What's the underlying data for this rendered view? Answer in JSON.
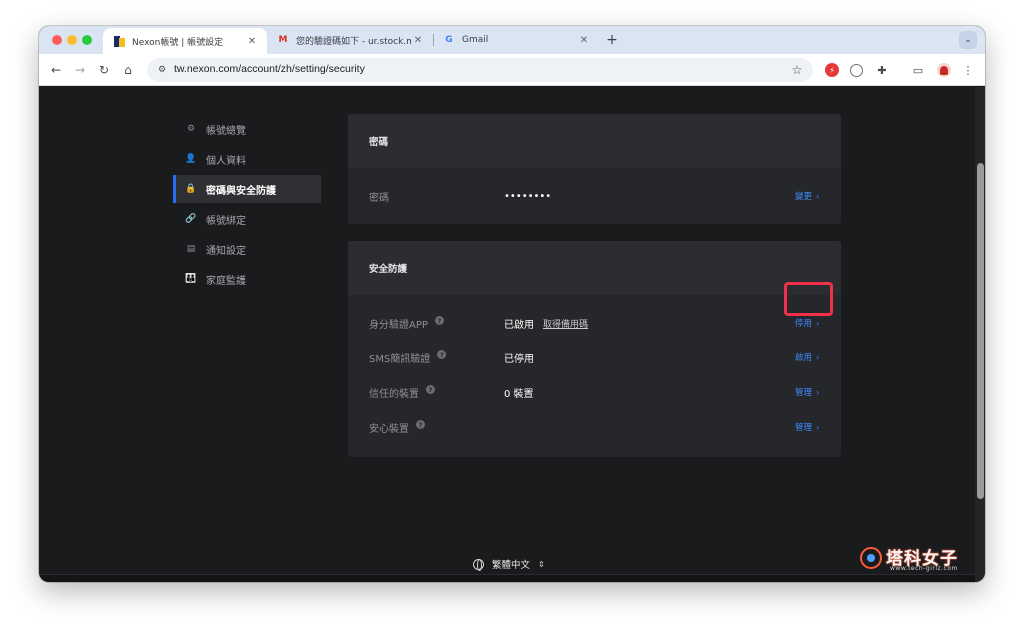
{
  "browser": {
    "tabs": [
      {
        "title": "Nexon帳號 | 帳號設定",
        "icon": "nexon-logo",
        "active": true
      },
      {
        "title": "您的驗證碼如下 - ur.stock.ma",
        "icon": "gmail-icon",
        "active": false
      },
      {
        "title": "Gmail",
        "icon": "google-icon",
        "active": false
      }
    ],
    "new_tab_symbol": "+",
    "tab_menu_symbol": "⌄",
    "url": "tw.nexon.com/account/zh/setting/security"
  },
  "sidebar": {
    "items": [
      {
        "label": "帳號總覽",
        "icon": "gear-icon",
        "glyph": "⚙",
        "active": false
      },
      {
        "label": "個人資料",
        "icon": "person-icon",
        "glyph": "👤",
        "active": false
      },
      {
        "label": "密碼與安全防護",
        "icon": "lock-icon",
        "glyph": "🔒",
        "active": true
      },
      {
        "label": "帳號綁定",
        "icon": "link-icon",
        "glyph": "🔗",
        "active": false
      },
      {
        "label": "通知設定",
        "icon": "message-icon",
        "glyph": "▤",
        "active": false
      },
      {
        "label": "家庭監護",
        "icon": "family-icon",
        "glyph": "👪",
        "active": false
      }
    ]
  },
  "password_card": {
    "title": "密碼",
    "row": {
      "label": "密碼",
      "value": "••••••••",
      "action": "變更"
    }
  },
  "security_card": {
    "title": "安全防護",
    "rows": [
      {
        "label": "身分驗證APP",
        "value": "已啟用",
        "sub": "取得備用碼",
        "action": "停用"
      },
      {
        "label": "SMS簡訊驗證",
        "value": "已停用",
        "sub": "",
        "action": "啟用"
      },
      {
        "label": "信任的裝置",
        "value": "0 裝置",
        "sub": "",
        "action": "管理"
      },
      {
        "label": "安心裝置",
        "value": "",
        "sub": "",
        "action": "管理"
      }
    ]
  },
  "language": {
    "label": "繁體中文"
  },
  "watermark": {
    "title": "塔科女子",
    "subtitle": "www.tech-girlz.com"
  },
  "colors": {
    "accent": "#3d8bff",
    "highlight": "#f2304a",
    "page_bg": "#1a1b1d",
    "card_bg": "#26272a"
  }
}
